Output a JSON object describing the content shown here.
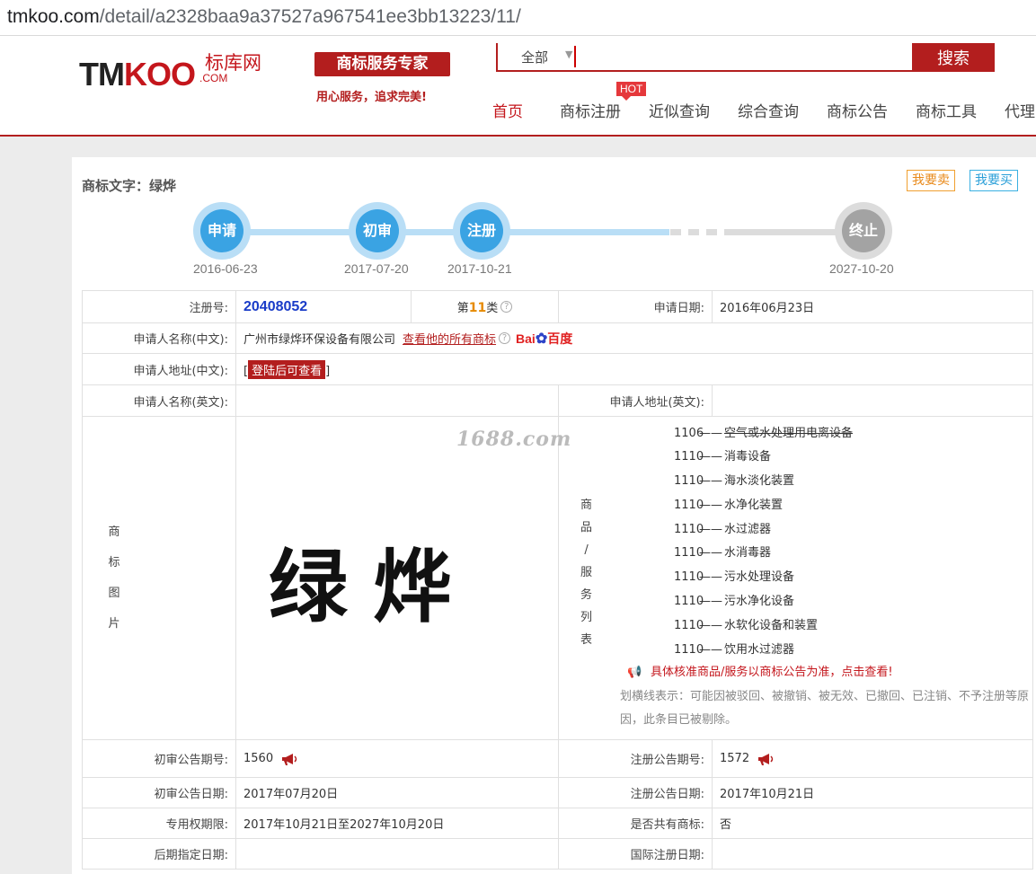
{
  "browser": {
    "url_domain": "tmkoo.com",
    "url_path": "/detail/a2328baa9a37527a967541ee3bb13223/11/"
  },
  "header": {
    "logo_prefix": "TM",
    "logo_koo": "KOO",
    "logo_cn": "标库网",
    "logo_com": ".COM",
    "slogan": "商标服务专家",
    "slogan_sub": "用心服务，追求完美!",
    "search_scope": "全部",
    "search_button": "搜索",
    "hot_badge": "HOT",
    "nav": [
      "首页",
      "商标注册",
      "近似查询",
      "综合查询",
      "商标公告",
      "商标工具",
      "代理"
    ]
  },
  "detail": {
    "title": "商标文字：绿烨",
    "sell_label": "我要卖",
    "buy_label": "我要买",
    "timeline": [
      {
        "stage": "申请",
        "date": "2016-06-23"
      },
      {
        "stage": "初审",
        "date": "2017-07-20"
      },
      {
        "stage": "注册",
        "date": "2017-10-21"
      },
      {
        "stage": "终止",
        "date": "2027-10-20"
      }
    ],
    "labels": {
      "reg_no": "注册号:",
      "cls_prefix": "第",
      "cls_suffix": "类",
      "apply_date": "申请日期:",
      "applicant_cn": "申请人名称(中文):",
      "address_cn": "申请人地址(中文):",
      "applicant_en": "申请人名称(英文):",
      "address_en": "申请人地址(英文):",
      "mark_image": [
        "商",
        "标",
        "图",
        "片"
      ],
      "goods_list": [
        "商",
        "品",
        "/",
        "服",
        "务",
        "列",
        "表"
      ],
      "prelim_no": "初审公告期号:",
      "reg_pub_no": "注册公告期号:",
      "prelim_date": "初审公告日期:",
      "reg_pub_date": "注册公告日期:",
      "exclusive_period": "专用权期限:",
      "shared": "是否共有商标:",
      "later_date": "后期指定日期:",
      "intl_date": "国际注册日期:"
    },
    "values": {
      "reg_no": "20408052",
      "cls": "11",
      "apply_date": "2016年06月23日",
      "applicant_cn": "广州市绿烨环保设备有限公司",
      "all_marks_link": "查看他的所有商标",
      "baidu_text_a": "Bai",
      "baidu_text_b": "百度",
      "login_view": "登陆后可查看",
      "mark_text": "绿烨",
      "watermark": "1688.com",
      "prelim_no": "1560",
      "reg_pub_no": "1572",
      "prelim_date": "2017年07月20日",
      "reg_pub_date": "2017年10月21日",
      "exclusive_period": "2017年10月21日至2027年10月20日",
      "shared": "否"
    },
    "goods": [
      {
        "code": "1106",
        "name": "空气或水处理用电离设备",
        "struck": true
      },
      {
        "code": "1110",
        "name": "消毒设备",
        "struck": false
      },
      {
        "code": "1110",
        "name": "海水淡化装置",
        "struck": false
      },
      {
        "code": "1110",
        "name": "水净化装置",
        "struck": false
      },
      {
        "code": "1110",
        "name": "水过滤器",
        "struck": false
      },
      {
        "code": "1110",
        "name": "水消毒器",
        "struck": false
      },
      {
        "code": "1110",
        "name": "污水处理设备",
        "struck": false
      },
      {
        "code": "1110",
        "name": "污水净化设备",
        "struck": false
      },
      {
        "code": "1110",
        "name": "水软化设备和装置",
        "struck": false
      },
      {
        "code": "1110",
        "name": "饮用水过滤器",
        "struck": false
      }
    ],
    "goods_dash": "——",
    "goods_notice": "具体核准商品/服务以商标公告为准，点击查看!",
    "goods_explain": "划横线表示：可能因被驳回、被撤销、被无效、已撤回、已注销、不予注册等原因，此条目已被剔除。"
  },
  "colors": {
    "brand_red": "#b31e1e",
    "timeline_blue": "#3aa3e3",
    "timeline_gray": "#a3a3a3",
    "regno_blue": "#1a3cc8"
  }
}
